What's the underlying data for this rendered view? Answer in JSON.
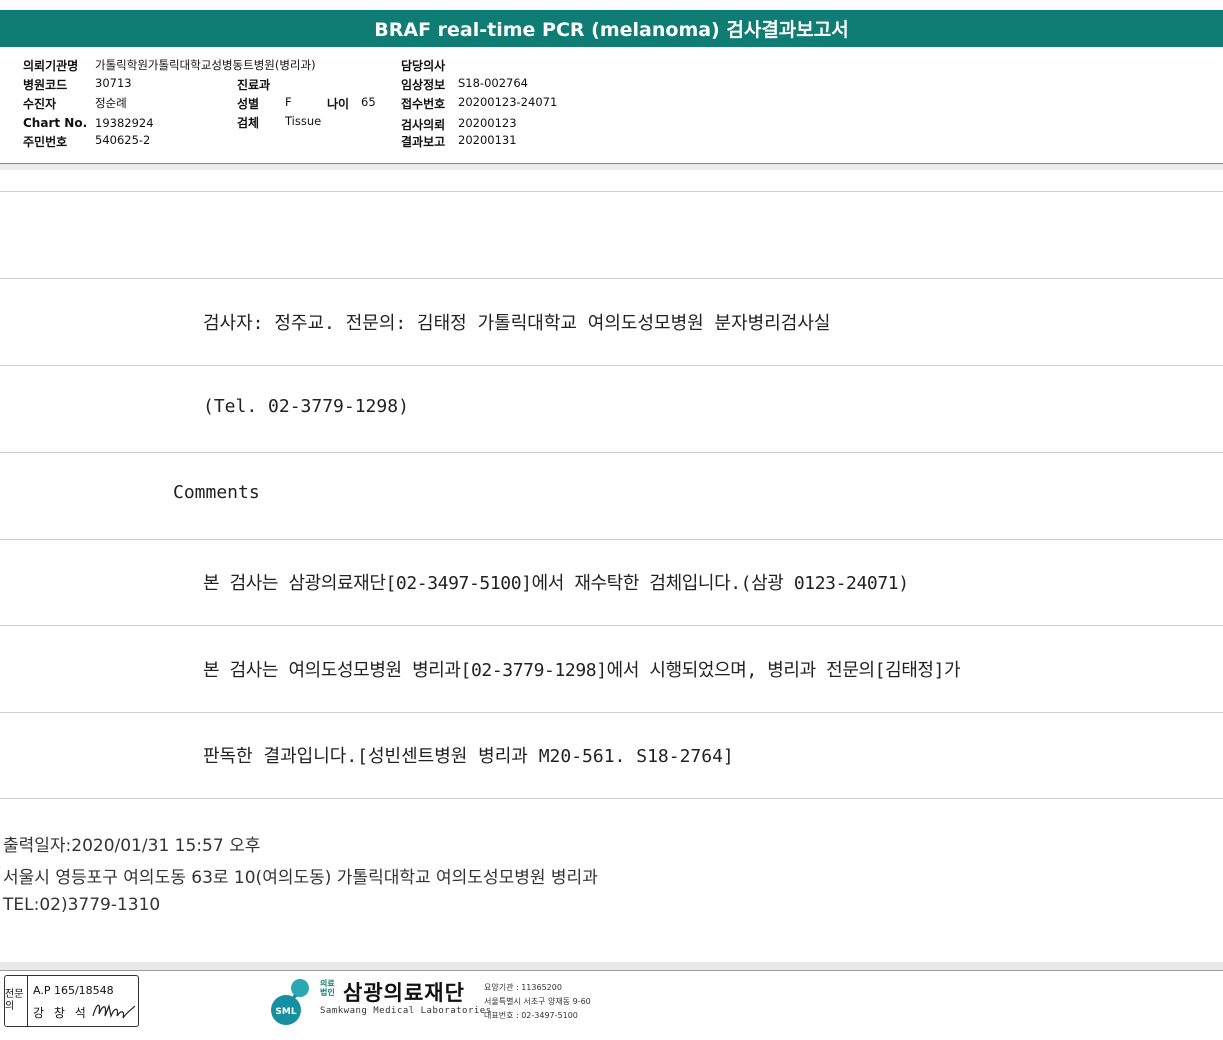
{
  "title": "BRAF real-time PCR (melanoma) 검사결과보고서",
  "header_fields": {
    "institution": {
      "label": "의뢰기관명",
      "value": "가톨릭학원가톨릭대학교성병동트병원(병리과)"
    },
    "hospital_code": {
      "label": "병원코드",
      "value": "30713"
    },
    "patient": {
      "label": "수진자",
      "value": "정순례"
    },
    "chart_no": {
      "label": "Chart No.",
      "value": "19382924"
    },
    "resident_no": {
      "label": "주민번호",
      "value": "540625-2"
    },
    "department": {
      "label": "진료과",
      "value": ""
    },
    "sex": {
      "label": "성별",
      "value": "F"
    },
    "age": {
      "label": "나이",
      "value": "65"
    },
    "specimen": {
      "label": "검체",
      "value": "Tissue"
    },
    "doctor": {
      "label": "담당의사",
      "value": ""
    },
    "clinical_info": {
      "label": "임상정보",
      "value": "S18-002764"
    },
    "accession_no": {
      "label": "접수번호",
      "value": "20200123-24071"
    },
    "request_date": {
      "label": "검사의뢰",
      "value": "20200123"
    },
    "report_date": {
      "label": "결과보고",
      "value": "20200131"
    }
  },
  "report_lines": [
    "검사자: 정주교.  전문의: 김태정 가톨릭대학교 여의도성모병원 분자병리검사실",
    "(Tel. 02-3779-1298)",
    "Comments",
    "본 검사는 삼광의료재단[02-3497-5100]에서 재수탁한 검체입니다.(삼광 0123-24071)",
    "본 검사는 여의도성모병원 병리과[02-3779-1298]에서 시행되었으며, 병리과 전문의[김태정]가",
    "판독한 결과입니다.[성빈센트병원 병리과 M20-561. S18-2764]"
  ],
  "footer": {
    "print_date": "출력일자:2020/01/31 15:57 오후",
    "address": "서울시 영등포구 여의도동 63로 10(여의도동) 가톨릭대학교 여의도성모병원 병리과",
    "tel": "TEL:02)3779-1310"
  },
  "stamp": {
    "side": "전문의",
    "ap": "A.P 165/18548",
    "name": "강 창 석"
  },
  "lab_logo": {
    "tag": "의료법인",
    "name": "삼광의료재단",
    "en": "Samkwang Medical Laboratories",
    "mark": "SML",
    "info1": "요양기관 : 11365200",
    "info2": "서울특별시 서초구 양재동 9-60",
    "info3": "대표번호 : 02-3497-5100"
  },
  "colors": {
    "header_teal": "#0f7d74"
  }
}
